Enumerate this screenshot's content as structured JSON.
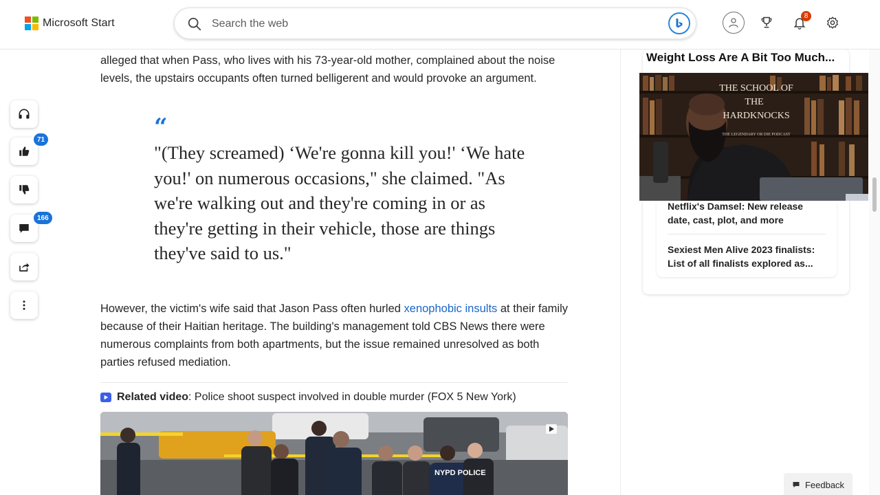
{
  "header": {
    "brand": "Microsoft Start",
    "search_placeholder": "Search the web",
    "notification_count": "8"
  },
  "rail": {
    "like_count": "71",
    "comment_count": "166"
  },
  "article": {
    "para1": "alleged that when Pass, who lives with his 73-year-old mother, complained about the noise levels, the upstairs occupants often turned belligerent and would provoke an argument.",
    "quote_mark": "“",
    "quote": "\"(They screamed) ‘We're gonna kill you!' ‘We hate you!' on numerous occasions,\" she claimed. \"As we're walking out and they're coming in or as they're getting in their vehicle, those are things they've said to us.\"",
    "para2_before": "However, the victim's wife said that Jason Pass often hurled ",
    "para2_link": "xenophobic insults",
    "para2_after": " at their family because of their Haitian heritage. The building's management told CBS News there were numerous complaints from both apartments, but the issue remained unresolved as both parties refused mediation.",
    "related_label": "Related video",
    "related_title": ": Police shoot suspect involved in double murder (FOX 5 New York)",
    "video_badge": "NYPD POLICE"
  },
  "sidebar": {
    "ad_title": "Weight Loss Are A Bit Too Much...",
    "pip_title_lines": [
      "THE SCHOOL OF",
      "THE",
      "HARDKNOCKS"
    ],
    "pip_subtitle": "THE LEGENDARY OR DIE PODCAST",
    "news": [
      {
        "title": "Netflix's Damsel: New release date, cast, plot, and more"
      },
      {
        "title": "Sexiest Men Alive 2023 finalists: List of all finalists explored as..."
      }
    ]
  },
  "feedback_label": "Feedback",
  "colors": {
    "accent": "#1a73d9",
    "link": "#1a67c7",
    "notif": "#d83b01"
  }
}
